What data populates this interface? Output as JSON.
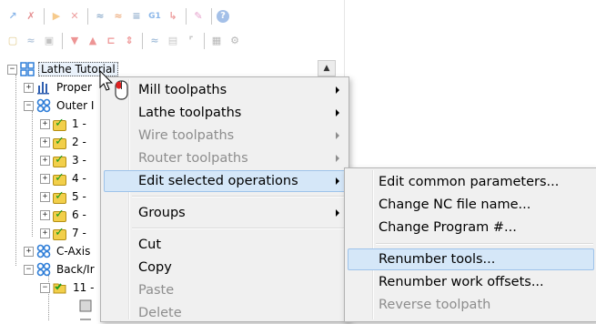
{
  "tree": {
    "root": "Lathe Tutorial",
    "items": [
      {
        "label": "Proper",
        "icon": "properties-icon"
      },
      {
        "label": "Outer I",
        "icon": "machine-group-icon"
      },
      {
        "label": "1 -",
        "icon": "operation-folder-icon"
      },
      {
        "label": "2 -",
        "icon": "operation-folder-icon"
      },
      {
        "label": "3 -",
        "icon": "operation-folder-icon"
      },
      {
        "label": "4 -",
        "icon": "operation-folder-icon"
      },
      {
        "label": "5 -",
        "icon": "operation-folder-icon"
      },
      {
        "label": "6 -",
        "icon": "operation-folder-icon"
      },
      {
        "label": "7 -",
        "icon": "operation-folder-icon"
      },
      {
        "label": "C-Axis",
        "icon": "machine-group-icon"
      },
      {
        "label": "Back/Ir",
        "icon": "machine-group-icon"
      },
      {
        "label": "11 -",
        "icon": "operation-folder-icon"
      }
    ]
  },
  "context_menu": {
    "items": [
      {
        "label": "Mill toolpaths",
        "submenu": true,
        "disabled": false
      },
      {
        "label": "Lathe toolpaths",
        "submenu": true,
        "disabled": false
      },
      {
        "label": "Wire toolpaths",
        "submenu": true,
        "disabled": true
      },
      {
        "label": "Router toolpaths",
        "submenu": true,
        "disabled": true
      },
      {
        "label": "Edit selected operations",
        "submenu": true,
        "disabled": false,
        "highlighted": true
      },
      {
        "label": "Groups",
        "submenu": true,
        "disabled": false
      },
      {
        "label": "Cut",
        "disabled": false
      },
      {
        "label": "Copy",
        "disabled": false
      },
      {
        "label": "Paste",
        "disabled": true
      },
      {
        "label": "Delete",
        "disabled": true
      }
    ]
  },
  "submenu": {
    "items": [
      {
        "label": "Edit common parameters...",
        "disabled": false
      },
      {
        "label": "Change NC file name...",
        "disabled": false
      },
      {
        "label": "Change Program #...",
        "disabled": false
      },
      {
        "label": "Renumber tools...",
        "disabled": false,
        "highlighted": true
      },
      {
        "label": "Renumber work offsets...",
        "disabled": false
      },
      {
        "label": "Reverse toolpath",
        "disabled": true
      }
    ]
  },
  "toolbar": {
    "row1": [
      "select-all-icon",
      "deselect-icon",
      "toggle-on-icon",
      "toggle-off-icon",
      "regen-icon",
      "regen-dirty-icon",
      "backplot-icon",
      "g1-icon",
      "post-icon",
      "highspeed-icon",
      "help-icon"
    ],
    "row2_glyphs": {
      "g1": "G1",
      "help": "?"
    }
  },
  "colors": {
    "menu_bg": "#f0f0f0",
    "highlight_bg": "#d5e7f8",
    "highlight_border": "#9ec3ea",
    "disabled_text": "#8d8d8d",
    "folder_yellow": "#f2cf4a",
    "check_green": "#1e9d1e",
    "machine_group_blue": "#2f7ed8"
  }
}
